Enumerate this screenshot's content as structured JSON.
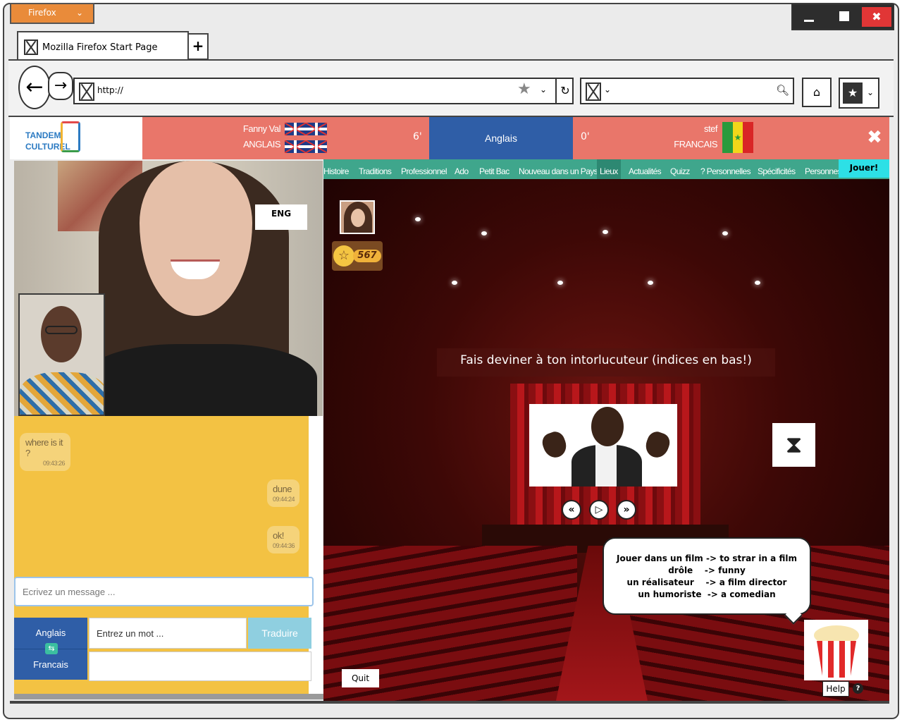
{
  "browser": {
    "app_menu": "Firefox",
    "tab_title": "Mozilla Firefox Start Page",
    "new_tab": "+",
    "url": "http://",
    "window_controls": {
      "close": "✖"
    }
  },
  "header": {
    "logo_line1": "TANDEM",
    "logo_line2": "CULTUREL",
    "left_user": {
      "name": "Fanny Val",
      "language": "ANGLAIS"
    },
    "left_score": "6'",
    "current_language": "Anglais",
    "right_score": "0'",
    "right_user": {
      "name": "stef",
      "language": "FRANCAIS"
    },
    "close": "✖",
    "colors": {
      "header": "#e9766a",
      "active_lang": "#2f5ea7",
      "menu": "#3fa68c"
    }
  },
  "video": {
    "lang_badge": "ENG"
  },
  "chat": {
    "messages": [
      {
        "text": "where is it ?",
        "time": "09:43:26"
      },
      {
        "text": "dune",
        "time": "09:44:24"
      },
      {
        "text": "ok!",
        "time": "09:44:36"
      }
    ],
    "message_placeholder": "Ecrivez un message ...",
    "translator": {
      "source_lang": "Anglais",
      "target_lang": "Francais",
      "word_placeholder": "Entrez un mot ...",
      "translate_label": "Traduire"
    }
  },
  "menu": {
    "items": [
      "Histoire",
      "Traditions",
      "Professionnel",
      "Ado",
      "Petit Bac",
      "Nouveau dans un Pays",
      "Lieux",
      "Actualités",
      "Quizz",
      "? Personnelles",
      "Spécificités",
      "Personnes"
    ],
    "active": "Lieux",
    "play_label": "Jouer!"
  },
  "game": {
    "score": "567",
    "prompt": "Fais deviner à ton intorlucuteur (indices en bas!)",
    "hints": [
      "Jouer dans un film -> to strar in a film",
      "drôle    -> funny",
      "un réalisateur    -> a film director",
      "un humoriste  -> a comedian"
    ],
    "quit_label": "Quit",
    "help_label": "Help",
    "help_icon": "?"
  }
}
